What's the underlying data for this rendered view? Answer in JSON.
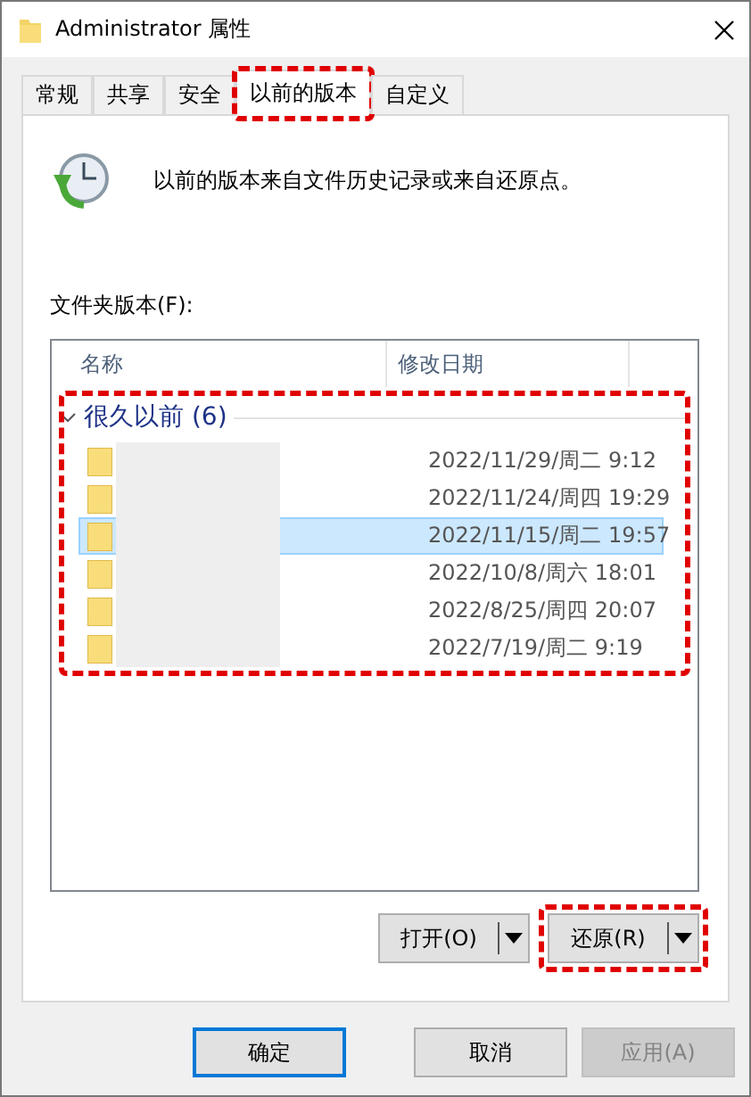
{
  "window": {
    "title": "Administrator 属性"
  },
  "tabs": [
    {
      "label": "常规",
      "selected": false,
      "highlighted": false
    },
    {
      "label": "共享",
      "selected": false,
      "highlighted": false
    },
    {
      "label": "安全",
      "selected": false,
      "highlighted": false
    },
    {
      "label": "以前的版本",
      "selected": true,
      "highlighted": true
    },
    {
      "label": "自定义",
      "selected": false,
      "highlighted": false
    }
  ],
  "description": "以前的版本来自文件历史记录或来自还原点。",
  "versions_label": "文件夹版本(F):",
  "list": {
    "columns": [
      "名称",
      "修改日期"
    ],
    "group": {
      "label": "很久以前 (6)",
      "expanded": true,
      "highlighted": true
    },
    "rows": [
      {
        "date": "2022/11/29/周二 9:12",
        "selected": false
      },
      {
        "date": "2022/11/24/周四 19:29",
        "selected": false
      },
      {
        "date": "2022/11/15/周二 19:57",
        "selected": true
      },
      {
        "date": "2022/10/8/周六 18:01",
        "selected": false
      },
      {
        "date": "2022/8/25/周四 20:07",
        "selected": false
      },
      {
        "date": "2022/7/19/周二 9:19",
        "selected": false
      }
    ]
  },
  "actions": [
    {
      "label": "打开(O)",
      "highlighted": false
    },
    {
      "label": "还原(R)",
      "highlighted": true
    }
  ],
  "buttons": [
    {
      "label": "确定",
      "default": true,
      "disabled": false
    },
    {
      "label": "取消",
      "default": false,
      "disabled": false
    },
    {
      "label": "应用(A)",
      "default": false,
      "disabled": true
    }
  ]
}
